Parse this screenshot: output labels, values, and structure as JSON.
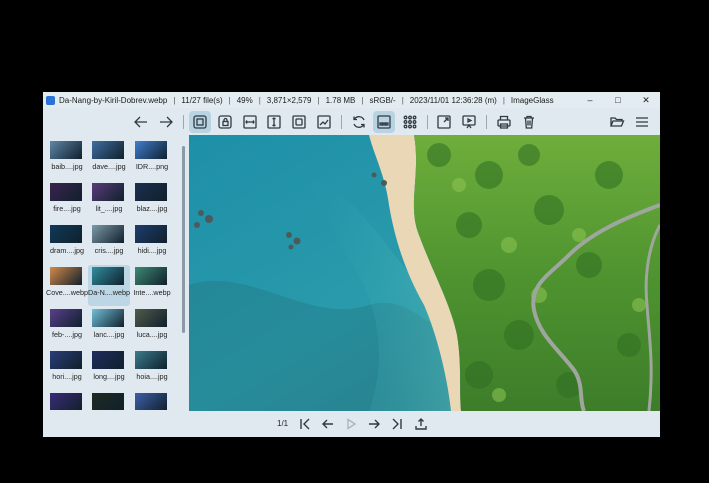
{
  "titlebar": {
    "file_name": "Da-Nang-by-Kiril-Dobrev.webp",
    "file_count": "11/27 file(s)",
    "zoom": "49%",
    "dimensions": "3,871×2,579",
    "file_size": "1.78 MB",
    "color_profile": "sRGB/-",
    "date": "2023/11/01 12:36:28 (m)",
    "app_name": "ImageGlass",
    "minimize_icon": "–",
    "maximize_icon": "□",
    "close_icon": "✕"
  },
  "gallery": {
    "thumbnails": [
      {
        "label": "baib....jpg",
        "color": "#5f86a8"
      },
      {
        "label": "dave....jpg",
        "color": "#3e6ea0"
      },
      {
        "label": "IDR....png",
        "color": "#3f7fd0"
      },
      {
        "label": "fire....jpg",
        "color": "#3a2350"
      },
      {
        "label": "lit_....jpg",
        "color": "#5a3b7a"
      },
      {
        "label": "blaz....jpg",
        "color": "#1c2f4f"
      },
      {
        "label": "dram....jpg",
        "color": "#0f3a5a"
      },
      {
        "label": "cris....jpg",
        "color": "#7e9aa8"
      },
      {
        "label": "hidi....jpg",
        "color": "#1e3d6e"
      },
      {
        "label": "Cove....webp",
        "color": "#d4894a"
      },
      {
        "label": "Da-N....webp",
        "color": "#2f8fa0"
      },
      {
        "label": "Inte....webp",
        "color": "#3d8a73"
      },
      {
        "label": "feb-....jpg",
        "color": "#5a3e8c"
      },
      {
        "label": "lanc....jpg",
        "color": "#72c0d8"
      },
      {
        "label": "luca....jpg",
        "color": "#525b4a"
      },
      {
        "label": "hori....jpg",
        "color": "#2a3d78"
      },
      {
        "label": "long....jpg",
        "color": "#1d2d5e"
      },
      {
        "label": "hoia....jpg",
        "color": "#3a7b8c"
      },
      {
        "label": "",
        "color": "#3b2b78"
      },
      {
        "label": "",
        "color": "#1e2a20"
      },
      {
        "label": "",
        "color": "#3e5fa8"
      }
    ],
    "selected_index": 10
  },
  "bottombar": {
    "page_counter": "1/1"
  },
  "colors": {
    "window_bg": "#dfe9ef",
    "active_button": "#b9d3e3",
    "icon_stroke": "#2f3a42"
  }
}
